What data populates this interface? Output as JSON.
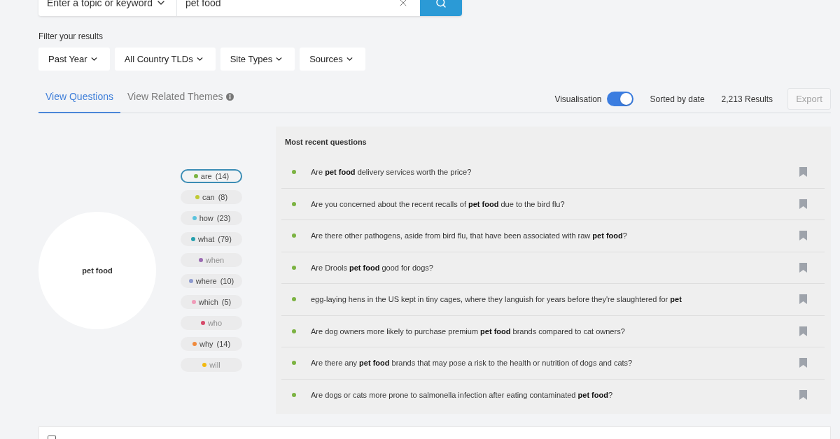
{
  "search": {
    "scope": "Enter a topic or keyword",
    "value": "pet food"
  },
  "filters": {
    "label": "Filter your results",
    "items": [
      "Past Year",
      "All Country TLDs",
      "Site Types",
      "Sources"
    ]
  },
  "tabs": [
    {
      "label": "View Questions",
      "selected": true,
      "info": false
    },
    {
      "label": "View Related Themes",
      "selected": false,
      "info": true
    }
  ],
  "toolbar": {
    "visualisation": {
      "label": "Visualisation",
      "on": true
    },
    "sort": "Sorted by date",
    "results": "2,213 Results",
    "export": {
      "label": "Export",
      "disabled": true
    }
  },
  "visualisation": {
    "topic": "pet food",
    "question_words": [
      {
        "word": "are",
        "count": "(14)",
        "selected": true,
        "disabled": false,
        "color": "#7cb342"
      },
      {
        "word": "can",
        "count": "(8)",
        "selected": false,
        "disabled": false,
        "color": "#c0ca33"
      },
      {
        "word": "how",
        "count": "(23)",
        "selected": false,
        "disabled": false,
        "color": "#5bc3dd"
      },
      {
        "word": "what",
        "count": "(79)",
        "selected": false,
        "disabled": false,
        "color": "#26a0ae"
      },
      {
        "word": "when",
        "selected": false,
        "disabled": true,
        "color": "#9b6bb3"
      },
      {
        "word": "where",
        "count": "(10)",
        "selected": false,
        "disabled": false,
        "color": "#8e9bd0"
      },
      {
        "word": "which",
        "count": "(5)",
        "selected": false,
        "disabled": false,
        "color": "#f09cb9"
      },
      {
        "word": "who",
        "selected": false,
        "disabled": true,
        "color": "#d64a6a"
      },
      {
        "word": "why",
        "count": "(14)",
        "selected": false,
        "disabled": false,
        "color": "#f08a3c"
      },
      {
        "word": "will",
        "selected": false,
        "disabled": true,
        "color": "#f2b90f"
      }
    ]
  },
  "recent_questions": {
    "title": "Most recent questions",
    "questions": [
      {
        "text": "Are **pet food** delivery services worth the price?",
        "color": "#7cb342"
      },
      {
        "text": "Are you concerned about the recent recalls of **pet food** due to the bird flu?",
        "color": "#7cb342"
      },
      {
        "text": "Are there other pathogens, aside from bird flu, that have been associated with raw **pet food**?",
        "color": "#7cb342"
      },
      {
        "text": "Are Drools **pet food** good for dogs?",
        "color": "#7cb342"
      },
      {
        "text": "egg-laying hens in the US kept in tiny cages, where they languish for years before they're slaughtered for **pet**",
        "color": "#7cb342"
      },
      {
        "text": "Are dog owners more likely to purchase premium **pet food** brands compared to cat owners?",
        "color": "#7cb342"
      },
      {
        "text": "Are there any **pet food** brands that may pose a risk to the health or nutrition of dogs and cats?",
        "color": "#7cb342"
      },
      {
        "text": "Are dogs or cats more prone to salmonella infection after eating contaminated **pet food**?",
        "color": "#7cb342"
      }
    ]
  },
  "selection_panel": {
    "checkbox": {
      "checked": false
    }
  }
}
